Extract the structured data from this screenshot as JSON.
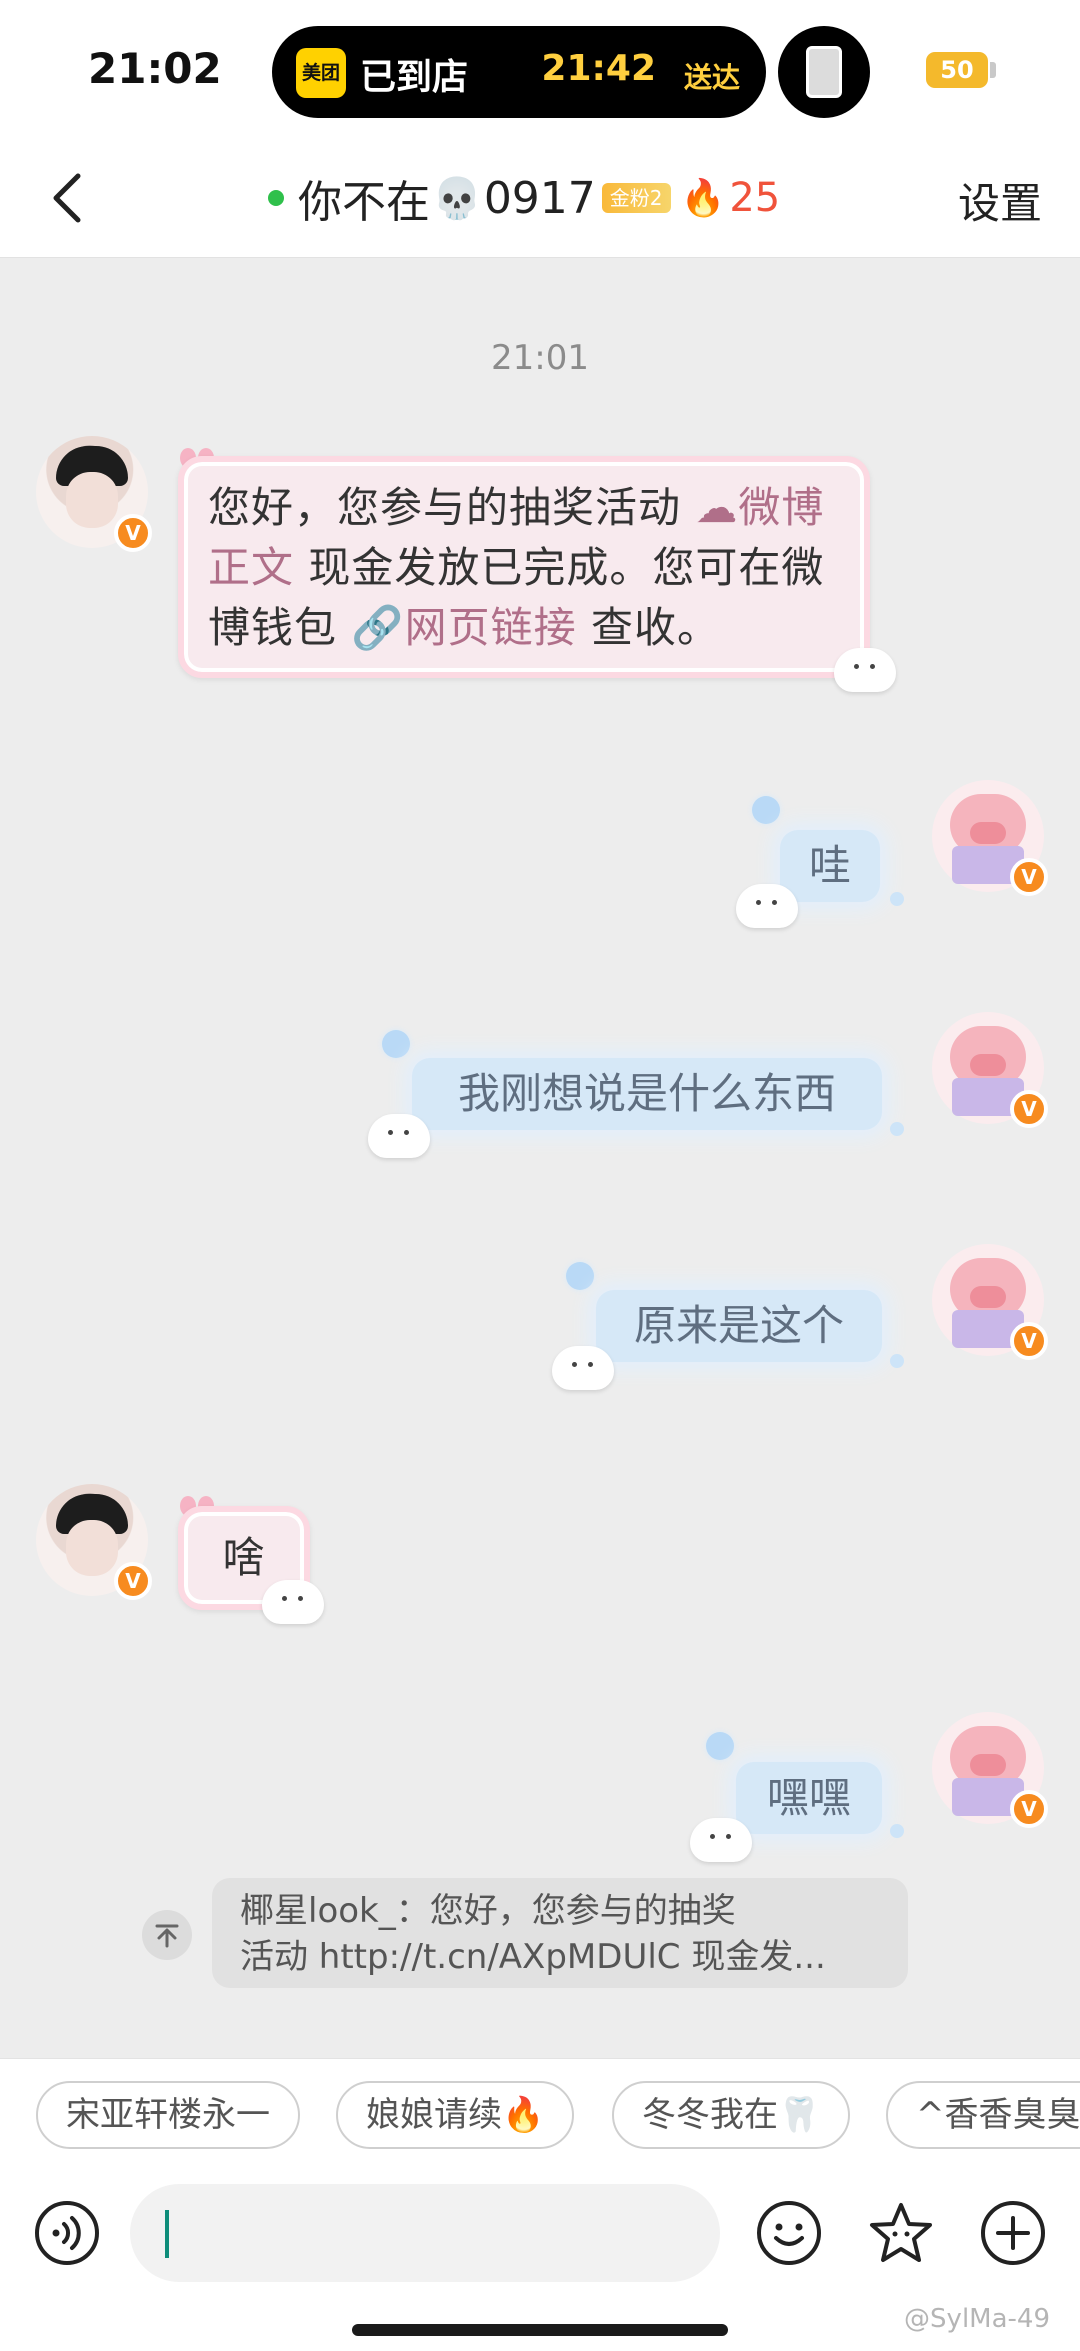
{
  "status_bar": {
    "time": "21:02",
    "island_app": "美团",
    "island_status": "已到店",
    "island_time": "21:42",
    "island_suffix": "送达",
    "battery": "50"
  },
  "header": {
    "name": "你不在",
    "skull": "💀",
    "number": "0917",
    "fan_badge": "金粉2",
    "fire": "🔥",
    "fire_count": "25",
    "settings": "设置"
  },
  "chat": {
    "timestamp": "21:01",
    "messages": [
      {
        "side": "left",
        "text_a": "您好，您参与的抽奖活动",
        "link_a_icon": "☁",
        "link_a": "微博正文",
        "text_b": "现金发放已完成。您可在微博钱包",
        "link_b_icon": "🔗",
        "link_b": "网页链接",
        "text_c": "查收。"
      },
      {
        "side": "right",
        "text": "哇"
      },
      {
        "side": "right",
        "text": "我刚想说是什么东西"
      },
      {
        "side": "right",
        "text": "原来是这个"
      },
      {
        "side": "left",
        "text": "啥"
      },
      {
        "side": "right",
        "text": "嘿嘿"
      }
    ]
  },
  "quote": {
    "line1": "椰星look_：您好，您参与的抽奖",
    "line2": "活动 http://t.cn/AXpMDUlC 现金发..."
  },
  "suggestions": [
    "宋亚轩楼永一",
    "娘娘请续🔥",
    "冬冬我在🦷",
    "^香香臭臭^"
  ],
  "input": {
    "placeholder": ""
  },
  "watermark": "@SylMa-49"
}
